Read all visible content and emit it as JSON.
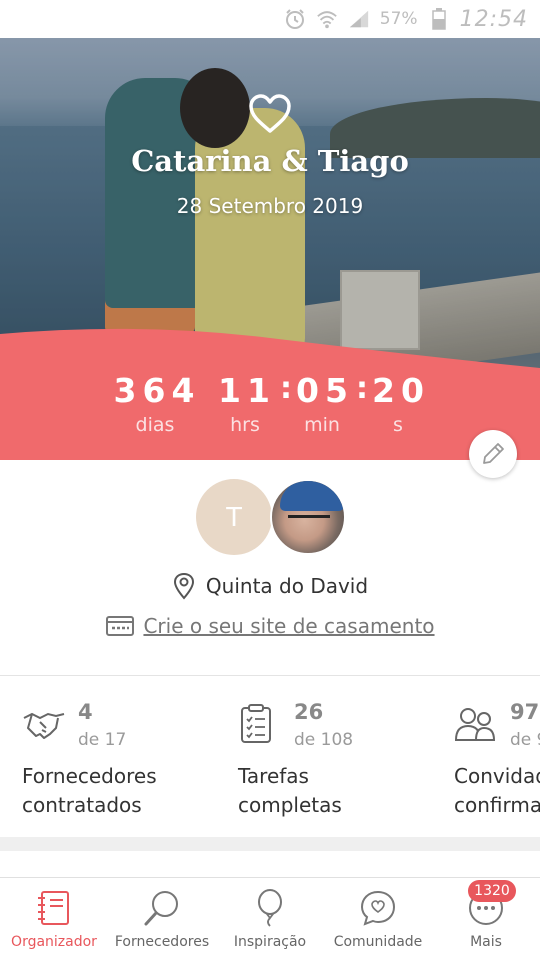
{
  "status_bar": {
    "battery_percent": "57%",
    "time": "12:54",
    "icons": [
      "alarm-icon",
      "wifi-icon",
      "signal-icon",
      "battery-icon"
    ]
  },
  "hero": {
    "couple_names": "Catarina & Tiago",
    "wedding_date": "28 Setembro 2019",
    "icon": "heart-outline-icon"
  },
  "countdown": {
    "days": "364",
    "hours": "11",
    "minutes": "05",
    "seconds": "20",
    "days_label": "dias",
    "hours_label": "hrs",
    "minutes_label": "min",
    "seconds_label": "s",
    "separator": ":"
  },
  "couple": {
    "avatar_initial": "T",
    "venue": "Quinta do David",
    "site_link": "Crie o seu site de casamento"
  },
  "stats": [
    {
      "icon": "handshake-icon",
      "count": "4",
      "of": "de 17",
      "label_line1": "Fornecedores",
      "label_line2": "contratados"
    },
    {
      "icon": "checklist-icon",
      "count": "26",
      "of": "de 108",
      "label_line1": "Tarefas",
      "label_line2": "completas"
    },
    {
      "icon": "guests-icon",
      "count": "97",
      "of": "de 9",
      "label_line1": "Convidad",
      "label_line2": "confirma"
    }
  ],
  "bottom_nav": {
    "items": [
      {
        "label": "Organizador",
        "icon": "notebook-icon",
        "active": true
      },
      {
        "label": "Fornecedores",
        "icon": "search-icon",
        "active": false
      },
      {
        "label": "Inspiração",
        "icon": "balloon-icon",
        "active": false
      },
      {
        "label": "Comunidade",
        "icon": "chat-heart-icon",
        "active": false
      },
      {
        "label": "Mais",
        "icon": "more-icon",
        "active": false
      }
    ],
    "badge": "1320"
  },
  "colors": {
    "accent": "#e8575c",
    "countdown_band": "#f06a6c",
    "avatar_bg": "#e8d8c7"
  }
}
